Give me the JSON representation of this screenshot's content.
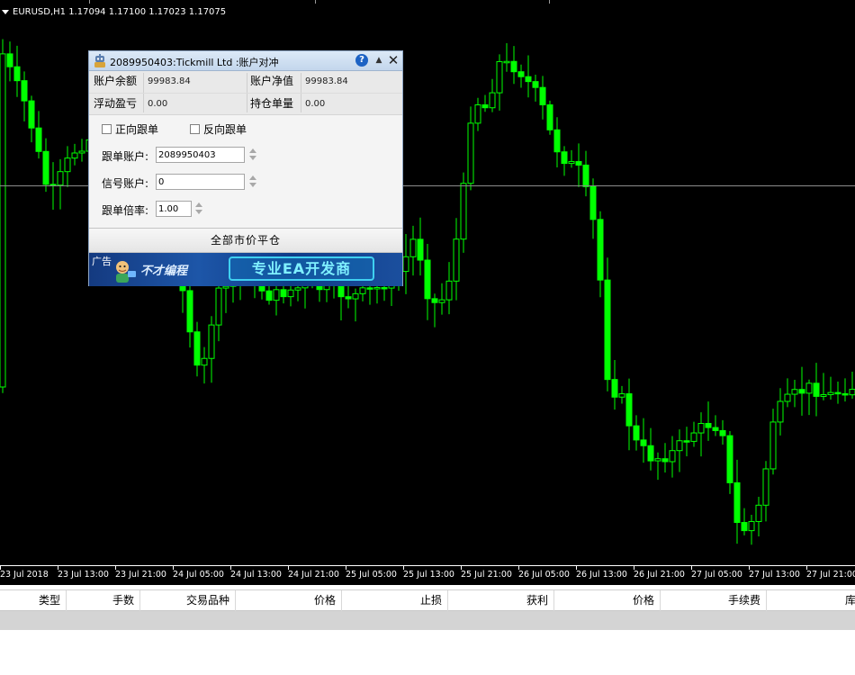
{
  "chart": {
    "header": "EURUSD,H1  1.17094 1.17100 1.17023 1.17075",
    "bull_color": "#000000",
    "bear_color": "#00ff00",
    "wick_color": "#00ff00",
    "background": "#000000",
    "time_labels": [
      "23 Jul 2018",
      "23 Jul 13:00",
      "23 Jul 21:00",
      "24 Jul 05:00",
      "24 Jul 13:00",
      "24 Jul 21:00",
      "25 Jul 05:00",
      "25 Jul 13:00",
      "25 Jul 21:00",
      "26 Jul 05:00",
      "26 Jul 13:00",
      "26 Jul 21:00",
      "27 Jul 05:00",
      "27 Jul 13:00",
      "27 Jul 21:00"
    ]
  },
  "dialog": {
    "title": "2089950403:Tickmill Ltd :账户对冲",
    "icons": {
      "app": "robot-icon",
      "help": "help-icon",
      "minimize": "minimize-icon",
      "close": "close-icon"
    },
    "help_glyph": "?",
    "balance_label": "账户余额",
    "balance_value": "99983.84",
    "equity_label": "账户净值",
    "equity_value": "99983.84",
    "floating_pl_label": "浮动盈亏",
    "floating_pl_value": "0.00",
    "position_orders_label": "持仓单量",
    "position_orders_value": "0.00",
    "forward_follow_label": "正向跟单",
    "forward_follow_checked": false,
    "reverse_follow_label": "反向跟单",
    "reverse_follow_checked": false,
    "follow_account_label": "跟单账户:",
    "follow_account_value": "2089950403",
    "signal_account_label": "信号账户:",
    "signal_account_value": "0",
    "follow_ratio_label": "跟单倍率:",
    "follow_ratio_value": "1.00",
    "close_all_label": "全部市价平仓",
    "ad_label": "广告",
    "ad_brand": "不才编程",
    "ad_slogan": "专业EA开发商"
  },
  "terminal": {
    "columns": [
      "类型",
      "手数",
      "交易品种",
      "价格",
      "止损",
      "获利",
      "价格",
      "手续费",
      "库存"
    ]
  }
}
